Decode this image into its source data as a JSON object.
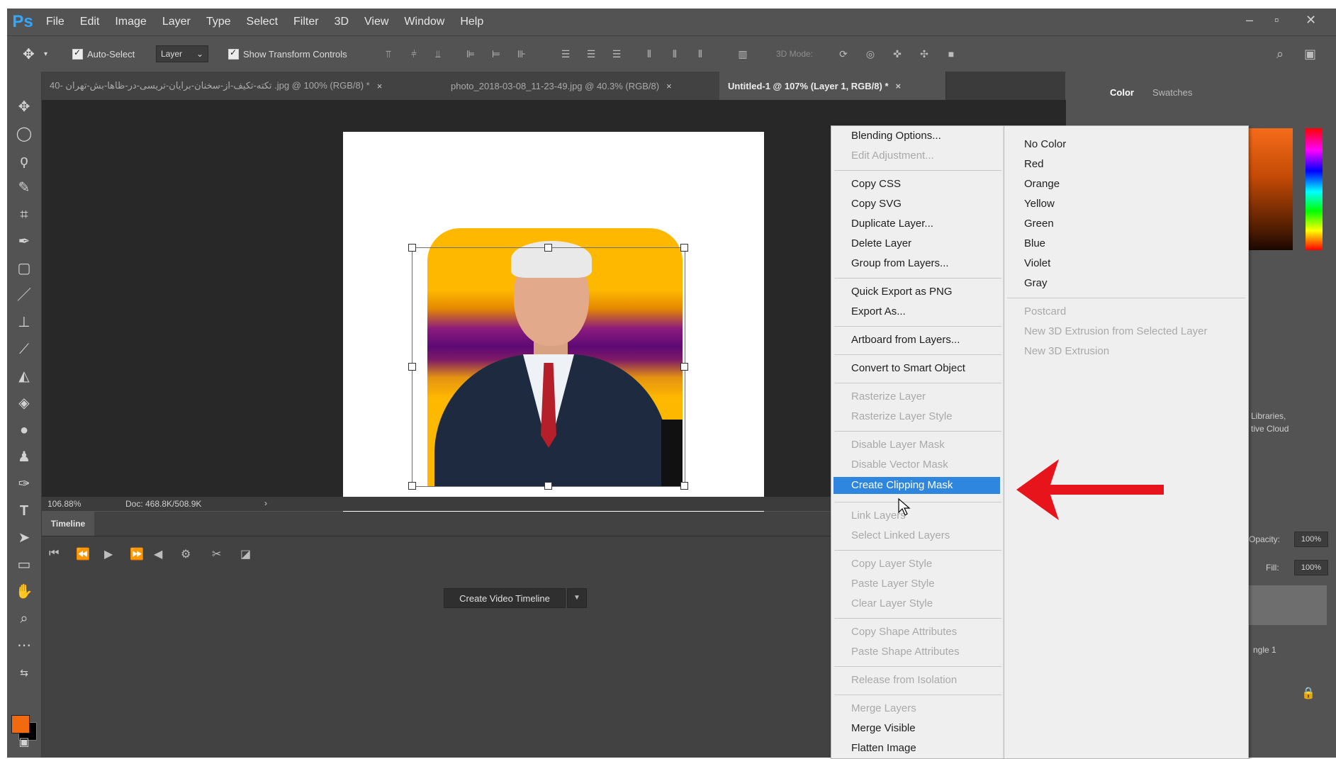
{
  "app": {
    "logo": "Ps"
  },
  "menubar": {
    "items": [
      "File",
      "Edit",
      "Image",
      "Layer",
      "Type",
      "Select",
      "Filter",
      "3D",
      "View",
      "Window",
      "Help"
    ]
  },
  "window_controls": {
    "minimize": "–",
    "maximize": "▫",
    "close": "✕"
  },
  "options": {
    "auto_select_label": "Auto-Select",
    "auto_select_target": "Layer",
    "show_transform_label": "Show Transform Controls",
    "mode_3d_label": "3D Mode:"
  },
  "tabs": [
    {
      "label": "40- تکته-تکیف-از-سخنان-برایان-تریسی-در-ظاها-بش-تهران .jpg @ 100% (RGB/8) *",
      "close": "×"
    },
    {
      "label": "photo_2018-03-08_11-23-49.jpg @ 40.3% (RGB/8)",
      "close": "×"
    },
    {
      "label": "Untitled-1 @ 107% (Layer 1, RGB/8) *",
      "close": "×"
    }
  ],
  "status": {
    "zoom": "106.88%",
    "doc": "Doc: 468.8K/508.9K"
  },
  "timeline": {
    "tab_label": "Timeline",
    "create_button": "Create Video Timeline"
  },
  "right_panel": {
    "tabs": [
      "Color",
      "Swatches"
    ],
    "libraries_text_1": "Libraries,",
    "libraries_text_2": "tive Cloud",
    "opacity_label": "Opacity:",
    "opacity_value": "100%",
    "fill_label": "Fill:",
    "fill_value": "100%",
    "layer_name": "ngle 1"
  },
  "context_menu": {
    "left": [
      {
        "label": "Blending Options...",
        "enabled": true
      },
      {
        "label": "Edit Adjustment...",
        "enabled": false
      },
      {
        "label": "Copy CSS",
        "enabled": true
      },
      {
        "label": "Copy SVG",
        "enabled": true
      },
      {
        "label": "Duplicate Layer...",
        "enabled": true
      },
      {
        "label": "Delete Layer",
        "enabled": true
      },
      {
        "label": "Group from Layers...",
        "enabled": true
      },
      {
        "label": "Quick Export as PNG",
        "enabled": true
      },
      {
        "label": "Export As...",
        "enabled": true
      },
      {
        "label": "Artboard from Layers...",
        "enabled": true
      },
      {
        "label": "Convert to Smart Object",
        "enabled": true
      },
      {
        "label": "Rasterize Layer",
        "enabled": false
      },
      {
        "label": "Rasterize Layer Style",
        "enabled": false
      },
      {
        "label": "Disable Layer Mask",
        "enabled": false
      },
      {
        "label": "Disable Vector Mask",
        "enabled": false
      },
      {
        "label": "Create Clipping Mask",
        "enabled": true,
        "highlighted": true
      },
      {
        "label": "Link Layers",
        "enabled": false
      },
      {
        "label": "Select Linked Layers",
        "enabled": false
      },
      {
        "label": "Copy Layer Style",
        "enabled": false
      },
      {
        "label": "Paste Layer Style",
        "enabled": false
      },
      {
        "label": "Clear Layer Style",
        "enabled": false
      },
      {
        "label": "Copy Shape Attributes",
        "enabled": false
      },
      {
        "label": "Paste Shape Attributes",
        "enabled": false
      },
      {
        "label": "Release from Isolation",
        "enabled": false
      },
      {
        "label": "Merge Layers",
        "enabled": false
      },
      {
        "label": "Merge Visible",
        "enabled": true
      },
      {
        "label": "Flatten Image",
        "enabled": true
      }
    ],
    "right": [
      {
        "label": "No Color",
        "enabled": true
      },
      {
        "label": "Red",
        "enabled": true
      },
      {
        "label": "Orange",
        "enabled": true
      },
      {
        "label": "Yellow",
        "enabled": true
      },
      {
        "label": "Green",
        "enabled": true
      },
      {
        "label": "Blue",
        "enabled": true
      },
      {
        "label": "Violet",
        "enabled": true
      },
      {
        "label": "Gray",
        "enabled": true
      },
      {
        "label": "Postcard",
        "enabled": false
      },
      {
        "label": "New 3D Extrusion from Selected Layer",
        "enabled": false
      },
      {
        "label": "New 3D Extrusion",
        "enabled": false
      }
    ]
  },
  "colors": {
    "foreground": "#f26a10",
    "background": "#000000",
    "highlight": "#2e86de",
    "annotation_arrow": "#e8141b"
  }
}
